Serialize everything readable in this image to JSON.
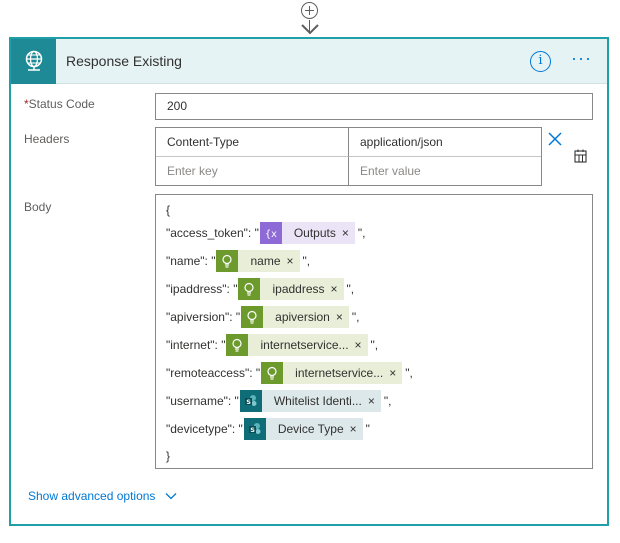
{
  "card": {
    "title": "Response Existing",
    "header_icon": "globe-icon",
    "info_icon_glyph": "i",
    "more_icon_glyph": "···",
    "accent_color": "#1d8a95"
  },
  "status_code": {
    "required_marker": "*",
    "label": "Status Code",
    "value": "200"
  },
  "headers": {
    "label": "Headers",
    "rows": [
      {
        "key": "Content-Type",
        "value": "application/json"
      }
    ],
    "key_placeholder": "Enter key",
    "value_placeholder": "Enter value"
  },
  "body": {
    "label": "Body",
    "open_brace": "{",
    "close_brace": "}",
    "lines": [
      {
        "prefix": "\"access_token\": \"",
        "token": "Outputs",
        "token_kind": "expression",
        "suffix": "\","
      },
      {
        "prefix": "\"name\": \"",
        "token": "name",
        "token_kind": "bulb",
        "suffix": "\","
      },
      {
        "prefix": "\"ipaddress\": \"",
        "token": "ipaddress",
        "token_kind": "bulb",
        "suffix": "\","
      },
      {
        "prefix": "\"apiversion\": \"",
        "token": "apiversion",
        "token_kind": "bulb",
        "suffix": "\","
      },
      {
        "prefix": "\"internet\": \"",
        "token": "internetservice...",
        "token_kind": "bulb",
        "suffix": "\","
      },
      {
        "prefix": "\"remoteaccess\": \"",
        "token": "internetservice...",
        "token_kind": "bulb",
        "suffix": "\","
      },
      {
        "prefix": "\"username\": \"",
        "token": "Whitelist Identi...",
        "token_kind": "sharepoint",
        "suffix": "\","
      },
      {
        "prefix": "\"devicetype\": \"",
        "token": "Device Type",
        "token_kind": "sharepoint",
        "suffix": "\""
      }
    ],
    "token_remove_glyph": "×"
  },
  "advanced_options": {
    "label": "Show advanced options"
  }
}
